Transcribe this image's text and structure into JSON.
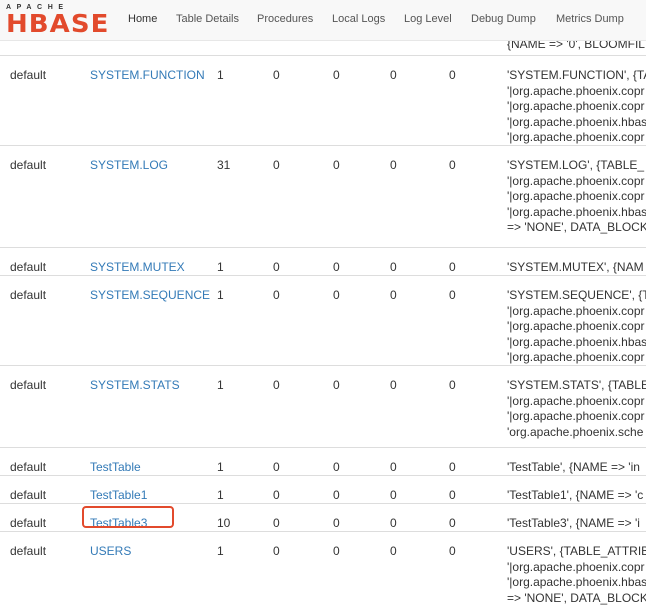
{
  "nav": {
    "logo_small": "APACHE",
    "logo_big": "HBASE",
    "items": [
      "Home",
      "Table Details",
      "Procedures",
      "Local Logs",
      "Log Level",
      "Debug Dump",
      "Metrics Dump"
    ]
  },
  "top_fragment": "{NAME => '0', BLOOMFIL",
  "rows": [
    {
      "namespace": "default",
      "name": "SYSTEM.FUNCTION",
      "c1": "1",
      "c2": "0",
      "c3": "0",
      "c4": "0",
      "c5": "0",
      "desc": [
        "'SYSTEM.FUNCTION', {TA",
        "'|org.apache.phoenix.copr",
        "'|org.apache.phoenix.copr",
        "'|org.apache.phoenix.hbas",
        "'|org.apache.phoenix.copr"
      ]
    },
    {
      "namespace": "default",
      "name": "SYSTEM.LOG",
      "c1": "31",
      "c2": "0",
      "c3": "0",
      "c4": "0",
      "c5": "0",
      "desc": [
        "'SYSTEM.LOG', {TABLE_",
        "'|org.apache.phoenix.copr",
        "'|org.apache.phoenix.copr",
        "'|org.apache.phoenix.hbas",
        "=> 'NONE', DATA_BLOCK"
      ]
    },
    {
      "namespace": "default",
      "name": "SYSTEM.MUTEX",
      "c1": "1",
      "c2": "0",
      "c3": "0",
      "c4": "0",
      "c5": "0",
      "desc": [
        "'SYSTEM.MUTEX', {NAM"
      ]
    },
    {
      "namespace": "default",
      "name": "SYSTEM.SEQUENCE",
      "c1": "1",
      "c2": "0",
      "c3": "0",
      "c4": "0",
      "c5": "0",
      "desc": [
        "'SYSTEM.SEQUENCE', {T",
        "'|org.apache.phoenix.copr",
        "'|org.apache.phoenix.copr",
        "'|org.apache.phoenix.hbas",
        "'|org.apache.phoenix.copr"
      ]
    },
    {
      "namespace": "default",
      "name": "SYSTEM.STATS",
      "c1": "1",
      "c2": "0",
      "c3": "0",
      "c4": "0",
      "c5": "0",
      "desc": [
        "'SYSTEM.STATS', {TABLE",
        "'|org.apache.phoenix.copr",
        "'|org.apache.phoenix.copr",
        "'org.apache.phoenix.sche"
      ]
    },
    {
      "namespace": "default",
      "name": "TestTable",
      "c1": "1",
      "c2": "0",
      "c3": "0",
      "c4": "0",
      "c5": "0",
      "desc": [
        "'TestTable', {NAME => 'in"
      ]
    },
    {
      "namespace": "default",
      "name": "TestTable1",
      "c1": "1",
      "c2": "0",
      "c3": "0",
      "c4": "0",
      "c5": "0",
      "desc": [
        "'TestTable1', {NAME => 'c"
      ]
    },
    {
      "namespace": "default",
      "name": "TestTable3",
      "c1": "10",
      "c2": "0",
      "c3": "0",
      "c4": "0",
      "c5": "0",
      "desc": [
        "'TestTable3', {NAME => 'i"
      ]
    },
    {
      "namespace": "default",
      "name": "USERS",
      "c1": "1",
      "c2": "0",
      "c3": "0",
      "c4": "0",
      "c5": "0",
      "desc": [
        "'USERS', {TABLE_ATTRIB",
        "'|org.apache.phoenix.copr",
        "'|org.apache.phoenix.hbas",
        "=> 'NONE', DATA_BLOCK"
      ]
    }
  ],
  "highlighted_row": "TestTable3",
  "colors": {
    "link": "#337ab7",
    "highlight": "#e24a2c",
    "logo": "#e24a2c"
  }
}
